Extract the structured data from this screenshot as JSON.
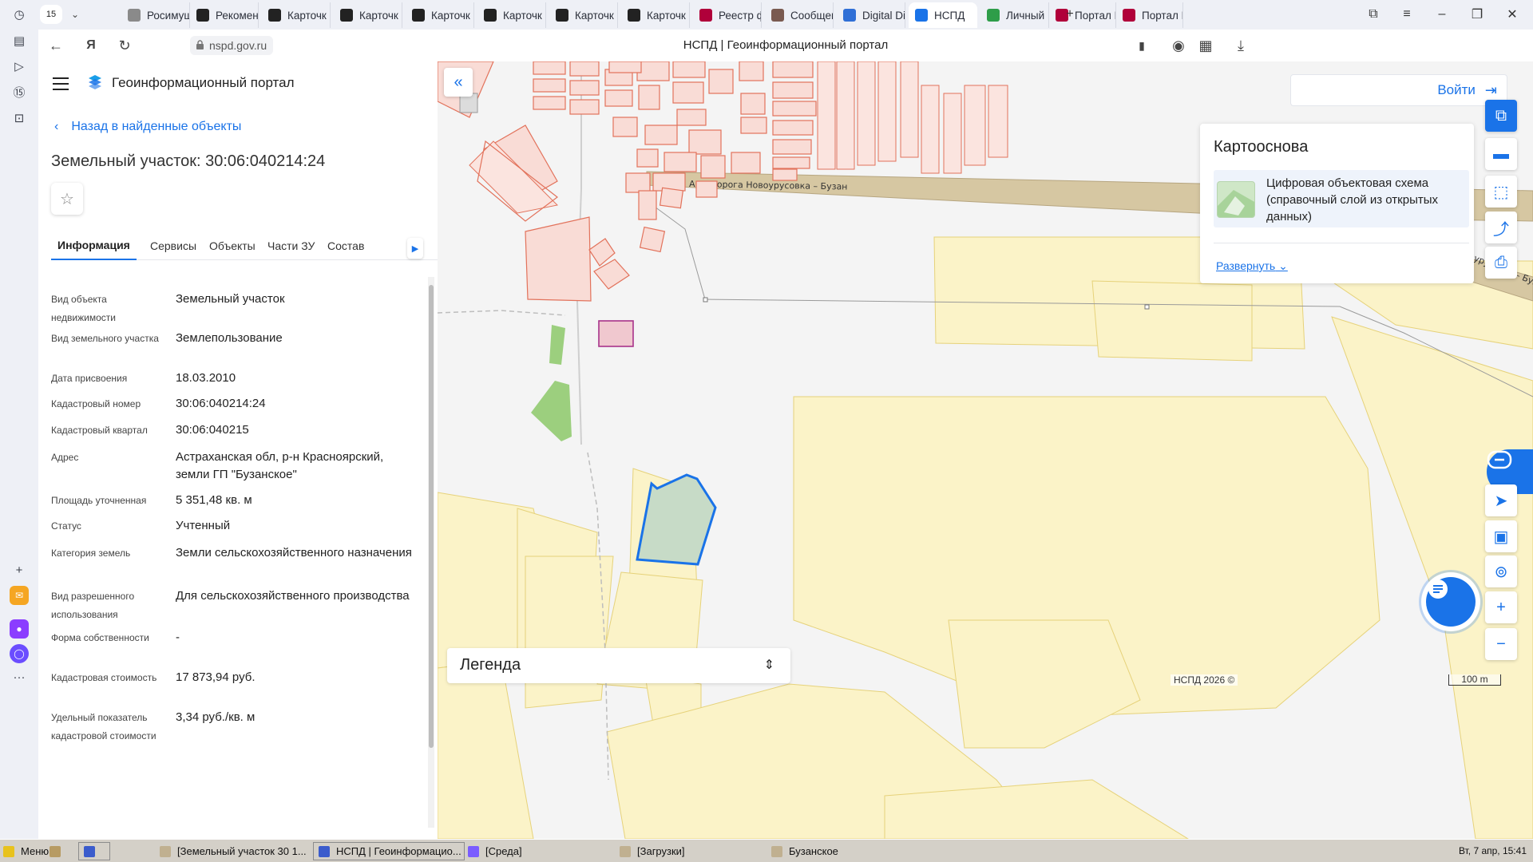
{
  "browser": {
    "tab_count": "15",
    "tabs": [
      {
        "label": "Росимущ",
        "color": "#8a8a8a"
      },
      {
        "label": "Рекомен",
        "color": "#222222"
      },
      {
        "label": "Карточк",
        "color": "#222222"
      },
      {
        "label": "Карточк",
        "color": "#222222"
      },
      {
        "label": "Карточк",
        "color": "#222222"
      },
      {
        "label": "Карточк",
        "color": "#222222"
      },
      {
        "label": "Карточк",
        "color": "#222222"
      },
      {
        "label": "Карточк",
        "color": "#222222"
      },
      {
        "label": "Реестр ф",
        "color": "#b0003a"
      },
      {
        "label": "Сообщен",
        "color": "#7a5a50"
      },
      {
        "label": "Digital Di",
        "color": "#2f6fd6"
      },
      {
        "label": "НСПД",
        "color": "#1a73e8"
      },
      {
        "label": "Личный",
        "color": "#2e9d49"
      },
      {
        "label": "Портал Р",
        "color": "#b0003a"
      },
      {
        "label": "Портал Р",
        "color": "#b0003a"
      }
    ],
    "url": "nspd.gov.ru",
    "page_title": "НСПД | Геоинформационный портал"
  },
  "panel": {
    "brand": "Геоинформационный портал",
    "back_link": "Назад в найденные объекты",
    "object_title": "Земельный участок: 30:06:040214:24",
    "tabs": [
      "Информация",
      "Сервисы",
      "Объекты",
      "Части ЗУ",
      "Состав"
    ],
    "properties": [
      {
        "key": "Вид объекта недвижимости",
        "value": "Земельный участок"
      },
      {
        "key": "Вид земельного участка",
        "value": "Землепользование"
      },
      {
        "key": "Дата присвоения",
        "value": "18.03.2010"
      },
      {
        "key": "Кадастровый номер",
        "value": "30:06:040214:24"
      },
      {
        "key": "Кадастровый квартал",
        "value": "30:06:040215"
      },
      {
        "key": "Адрес",
        "value": "Астраханская обл, р-н Красноярский, земли ГП \"Бузанское\""
      },
      {
        "key": "Площадь уточненная",
        "value": "5 351,48 кв. м"
      },
      {
        "key": "Статус",
        "value": "Учтенный"
      },
      {
        "key": "Категория земель",
        "value": "Земли сельскохозяйственного назначения"
      },
      {
        "key": "Вид разрешенного использования",
        "value": "Для сельскохозяйственного производства"
      },
      {
        "key": "Форма собственности",
        "value": "-"
      },
      {
        "key": "Кадастровая стоимость",
        "value": "17 873,94 руб."
      },
      {
        "key": "Удельный показатель кадастровой стоимости",
        "value": "3,34 руб./кв. м"
      }
    ]
  },
  "map": {
    "login_label": "Войти",
    "basemap_heading": "Картооснова",
    "basemap_name": "Цифровая объектовая схема (справочный слой из открытых данных)",
    "expand_label": "Развернуть",
    "road_label_1": "Автодорога Новоурусовка – Бузан",
    "road_label_2": "Автодорога Новоурусовка – Бузан",
    "legend_label": "Легенда",
    "copyright": "НСПД 2026 ©",
    "scale_label": "100 m",
    "colors": {
      "accent": "#1a73e8",
      "parcel_fill": "#fbf3c8",
      "parcel_stroke": "#e6d27a",
      "building_stroke": "#e2725b",
      "selected_stroke": "#1a73e8"
    }
  },
  "taskbar": {
    "menu": "Меню",
    "items": [
      "[Земельный участок 30 1...",
      "НСПД | Геоинформацио...",
      "[Среда]",
      "[Загрузки]",
      "Бузанское"
    ],
    "clock": "Вт, 7 апр, 15:41"
  }
}
